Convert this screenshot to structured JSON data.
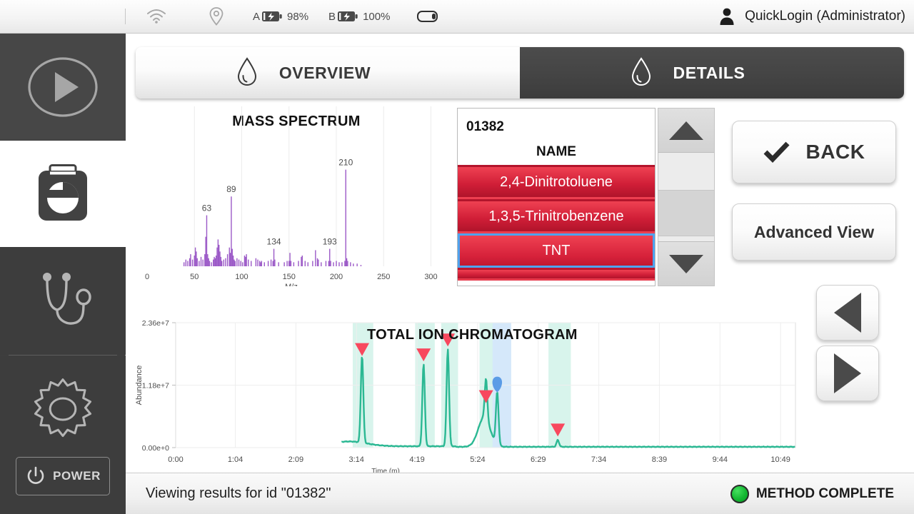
{
  "topbar": {
    "icons": [
      "wifi-icon",
      "location-pin-icon",
      "battery-icon",
      "battery-icon",
      "battery-icon"
    ],
    "battery_a": {
      "letter": "A",
      "percent": "98%",
      "state": "charging"
    },
    "battery_b": {
      "letter": "B",
      "percent": "100%",
      "state": "charging"
    },
    "user": {
      "icon": "person-icon",
      "name": "QuickLogin (Administrator)"
    }
  },
  "sidebar": {
    "items": [
      {
        "name": "run-play",
        "icon": "play-circle-icon",
        "active": false
      },
      {
        "name": "results-report",
        "icon": "clipboard-pie-chart-icon",
        "active": true
      },
      {
        "name": "diagnostics",
        "icon": "stethoscope-icon",
        "active": false
      },
      {
        "name": "settings",
        "icon": "gear-icon",
        "active": false
      }
    ],
    "power": {
      "label": "POWER",
      "icon": "power-icon"
    }
  },
  "tabs": [
    {
      "label": "OVERVIEW",
      "icon": "droplet-icon",
      "active": false
    },
    {
      "label": "DETAILS",
      "icon": "droplet-icon",
      "active": true
    }
  ],
  "list": {
    "id": "01382",
    "header": "NAME",
    "rows": [
      {
        "name": "2,4-Dinitrotoluene",
        "selected": false
      },
      {
        "name": "1,3,5-Trinitrobenzene",
        "selected": false
      },
      {
        "name": "TNT",
        "selected": true
      }
    ],
    "scroll": {
      "up_icon": "triangle-up-icon",
      "down_icon": "triangle-down-icon"
    }
  },
  "buttons": {
    "back": {
      "label": "BACK",
      "icon": "check-icon"
    },
    "advanced_view": {
      "label": "Advanced View"
    },
    "prev": {
      "icon": "triangle-left-icon"
    },
    "next": {
      "icon": "triangle-right-icon"
    }
  },
  "statusbar": {
    "message": "Viewing results for id \"01382\"",
    "indicator": {
      "label": "METHOD COMPLETE",
      "color": "#17b832"
    }
  },
  "chart_data": [
    {
      "type": "bar",
      "title": "MASS SPECTRUM",
      "xlabel": "M/z",
      "ylabel": "",
      "xlim": [
        0,
        320
      ],
      "ylim": [
        0,
        100
      ],
      "grid": true,
      "xticks": [
        0,
        50,
        100,
        150,
        200,
        250,
        300
      ],
      "xticklabels": [
        "0",
        "50",
        "100",
        "150",
        "200",
        "250",
        "300"
      ],
      "color": "#9b59c7",
      "annotations": [
        {
          "x": 63,
          "label": "63"
        },
        {
          "x": 89,
          "label": "89"
        },
        {
          "x": 134,
          "label": "134"
        },
        {
          "x": 193,
          "label": "193"
        },
        {
          "x": 210,
          "label": "210"
        }
      ],
      "x": [
        39,
        41,
        43,
        45,
        46,
        48,
        50,
        51,
        52,
        53,
        55,
        57,
        59,
        61,
        62,
        63,
        64,
        65,
        66,
        68,
        70,
        71,
        72,
        73,
        74,
        75,
        76,
        77,
        78,
        79,
        81,
        83,
        85,
        87,
        88,
        89,
        90,
        91,
        92,
        93,
        95,
        97,
        99,
        101,
        103,
        104,
        105,
        107,
        110,
        115,
        117,
        119,
        120,
        121,
        124,
        128,
        131,
        133,
        134,
        135,
        139,
        145,
        148,
        150,
        151,
        152,
        155,
        160,
        163,
        164,
        167,
        170,
        175,
        178,
        180,
        181,
        184,
        189,
        192,
        193,
        194,
        197,
        200,
        203,
        206,
        209,
        210,
        211,
        212,
        215,
        218,
        222,
        226
      ],
      "values": [
        3,
        5,
        4,
        6,
        9,
        5,
        8,
        14,
        11,
        6,
        4,
        7,
        5,
        9,
        22,
        38,
        9,
        6,
        4,
        3,
        5,
        7,
        6,
        8,
        14,
        20,
        16,
        11,
        7,
        4,
        5,
        6,
        9,
        14,
        10,
        52,
        13,
        8,
        5,
        4,
        6,
        5,
        4,
        3,
        8,
        7,
        9,
        5,
        4,
        6,
        5,
        4,
        3,
        4,
        3,
        4,
        5,
        4,
        13,
        5,
        3,
        3,
        4,
        4,
        10,
        4,
        3,
        4,
        7,
        8,
        4,
        3,
        4,
        12,
        6,
        5,
        3,
        4,
        4,
        13,
        4,
        3,
        4,
        3,
        3,
        4,
        72,
        6,
        4,
        3,
        2,
        2,
        1
      ]
    },
    {
      "type": "line",
      "title": "TOTAL ION CHROMATOGRAM",
      "xlabel": "Time (m)",
      "ylabel": "Abundance",
      "grid": true,
      "ylim": [
        0,
        23600000
      ],
      "yticks": [
        0,
        11800000,
        23600000
      ],
      "yticklabels": [
        "0.00e+0",
        "1.18e+7",
        "2.36e+7"
      ],
      "xticks": [
        0,
        64,
        129,
        194,
        259,
        324,
        389,
        454,
        519,
        584,
        649
      ],
      "xticklabels": [
        "0:00",
        "1:04",
        "2:09",
        "3:14",
        "4:19",
        "5:24",
        "6:29",
        "7:34",
        "8:39",
        "9:44",
        "10:49"
      ],
      "line_color": "#2bb893",
      "peak_marker_color": "#f8485e",
      "selected_marker_color": "#5b9ce6",
      "peaks": [
        {
          "time_s": 200,
          "abundance": 16500000,
          "marked": true,
          "selected": false
        },
        {
          "time_s": 266,
          "abundance": 15500000,
          "marked": true,
          "selected": false
        },
        {
          "time_s": 292,
          "abundance": 18300000,
          "marked": true,
          "selected": false
        },
        {
          "time_s": 333,
          "abundance": 7600000,
          "marked": true,
          "selected": false
        },
        {
          "time_s": 345,
          "abundance": 9900000,
          "marked": false,
          "selected": true
        },
        {
          "time_s": 410,
          "abundance": 1300000,
          "marked": true,
          "selected": false
        }
      ],
      "highlight_bands": [
        {
          "start_s": 190,
          "end_s": 212,
          "color": "#d8f4ec"
        },
        {
          "start_s": 257,
          "end_s": 278,
          "color": "#d8f4ec"
        },
        {
          "start_s": 285,
          "end_s": 303,
          "color": "#d8f4ec"
        },
        {
          "start_s": 326,
          "end_s": 342,
          "color": "#d8f4ec"
        },
        {
          "start_s": 340,
          "end_s": 360,
          "color": "#d5e8fa"
        },
        {
          "start_s": 400,
          "end_s": 424,
          "color": "#d8f4ec"
        }
      ]
    }
  ]
}
